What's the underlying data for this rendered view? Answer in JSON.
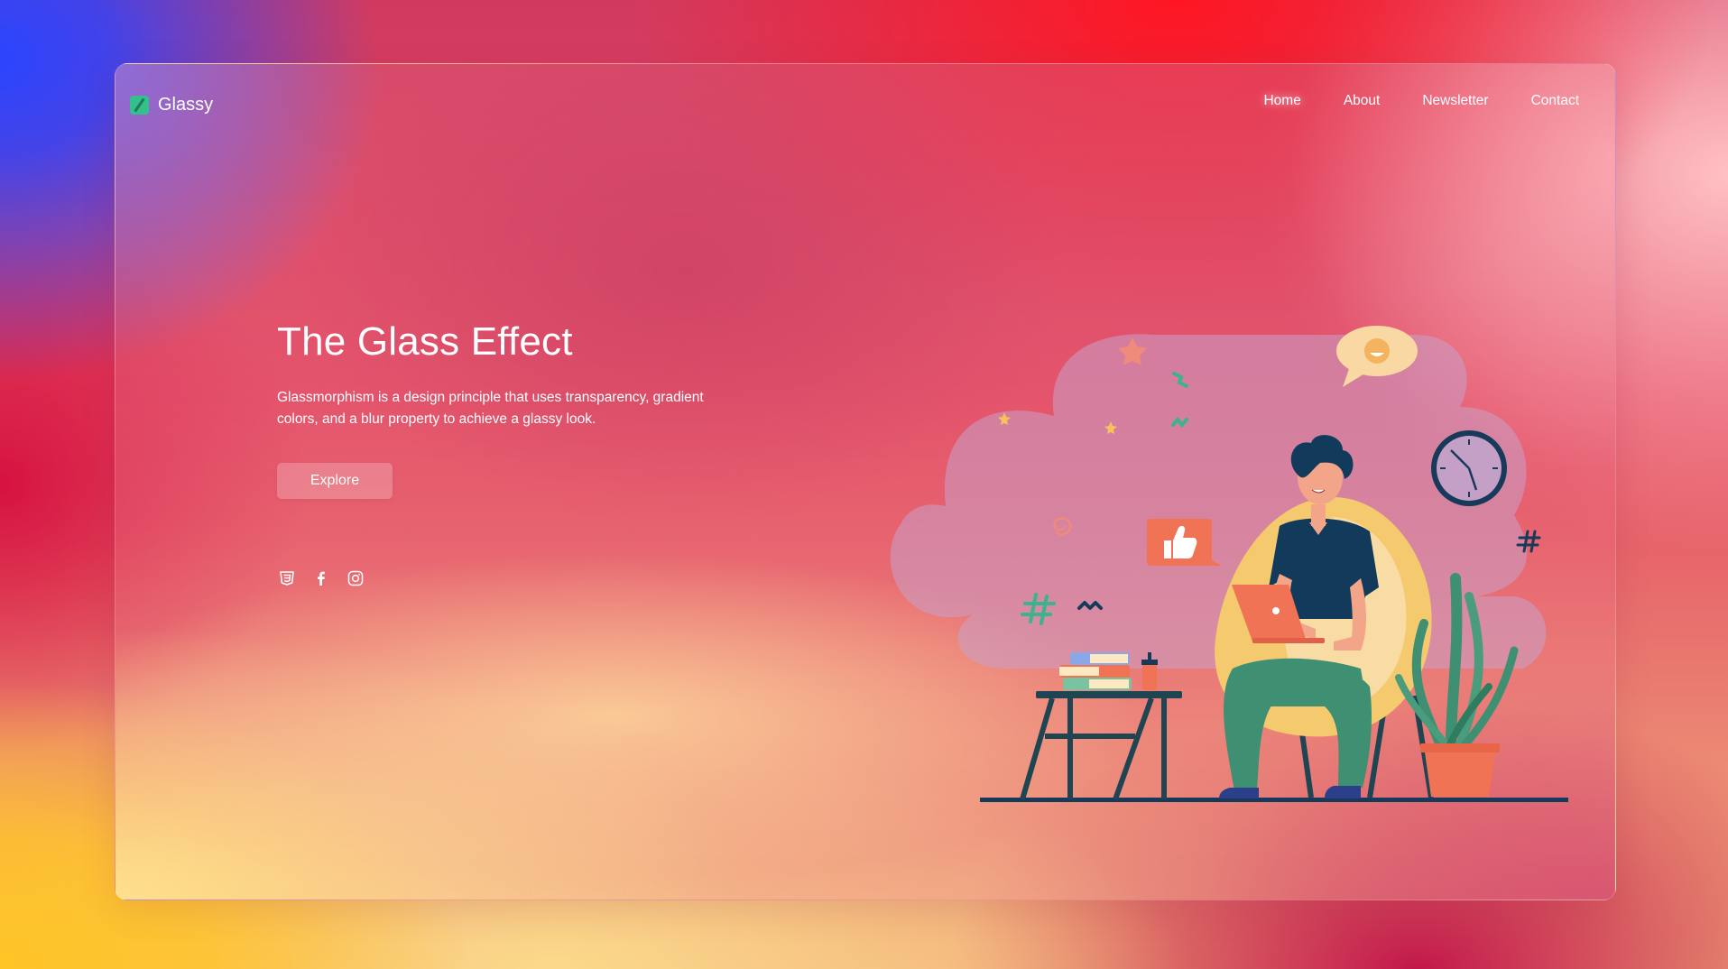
{
  "brand": {
    "name": "Glassy",
    "icon": "leaf-square-icon"
  },
  "nav": {
    "items": [
      {
        "label": "Home",
        "active": true
      },
      {
        "label": "About",
        "active": false
      },
      {
        "label": "Newsletter",
        "active": false
      },
      {
        "label": "Contact",
        "active": false
      }
    ]
  },
  "hero": {
    "title": "The Glass Effect",
    "description": "Glassmorphism is a design principle that uses transparency, gradient colors, and a blur property to achieve a glassy look.",
    "button_label": "Explore"
  },
  "socials": [
    {
      "name": "css3-icon"
    },
    {
      "name": "facebook-icon"
    },
    {
      "name": "instagram-icon"
    }
  ],
  "illustration": {
    "subject": "person-with-laptop-in-chair-illustration"
  },
  "colors": {
    "accent_green": "#33c18b",
    "text": "#ffffff"
  }
}
